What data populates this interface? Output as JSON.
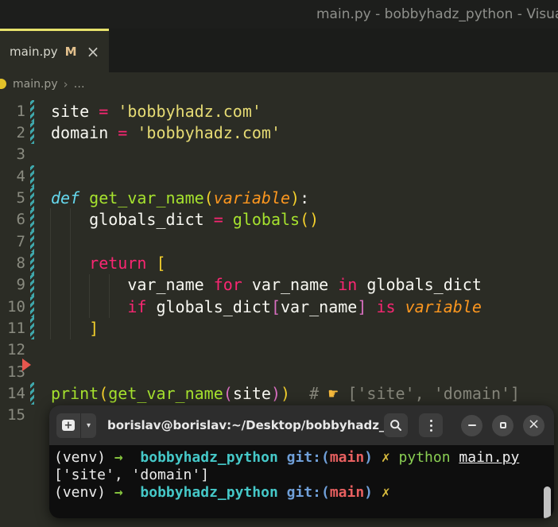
{
  "window": {
    "title": "main.py - bobbyhadz_python - Visua"
  },
  "tab": {
    "label": "main.py",
    "modified_badge": "M",
    "close_glyph": "×"
  },
  "breadcrumb": {
    "file": "main.py",
    "separator": "›",
    "ellipsis": "…"
  },
  "editor": {
    "lines": [
      {
        "num": "1",
        "gutter": "mod",
        "tokens": [
          [
            "site ",
            "w"
          ],
          [
            "= ",
            "p"
          ],
          [
            "'bobbyhadz.com'",
            "y"
          ]
        ]
      },
      {
        "num": "2",
        "gutter": "mod",
        "tokens": [
          [
            "domain ",
            "w"
          ],
          [
            "= ",
            "p"
          ],
          [
            "'bobbyhadz.com'",
            "y"
          ]
        ]
      },
      {
        "num": "3",
        "gutter": "",
        "tokens": []
      },
      {
        "num": "4",
        "gutter": "mod",
        "tokens": []
      },
      {
        "num": "5",
        "gutter": "mod",
        "tokens": [
          [
            "def ",
            "c"
          ],
          [
            "get_var_name",
            "g"
          ],
          [
            "(",
            "b1"
          ],
          [
            "variable",
            "o"
          ],
          [
            ")",
            "b1"
          ],
          [
            ":",
            "w"
          ]
        ]
      },
      {
        "num": "6",
        "gutter": "mod",
        "tokens": [
          [
            "    globals_dict ",
            "w"
          ],
          [
            "= ",
            "p"
          ],
          [
            "globals",
            "g"
          ],
          [
            "()",
            "b1"
          ]
        ]
      },
      {
        "num": "7",
        "gutter": "mod",
        "tokens": []
      },
      {
        "num": "8",
        "gutter": "mod",
        "tokens": [
          [
            "    ",
            "w"
          ],
          [
            "return",
            "p"
          ],
          [
            " ",
            "w"
          ],
          [
            "[",
            "b1"
          ]
        ]
      },
      {
        "num": "9",
        "gutter": "mod",
        "tokens": [
          [
            "        var_name ",
            "w"
          ],
          [
            "for",
            "p"
          ],
          [
            " var_name ",
            "w"
          ],
          [
            "in",
            "p"
          ],
          [
            " globals_dict",
            "w"
          ]
        ]
      },
      {
        "num": "10",
        "gutter": "mod",
        "tokens": [
          [
            "        ",
            "w"
          ],
          [
            "if",
            "p"
          ],
          [
            " globals_dict",
            "w"
          ],
          [
            "[",
            "b2"
          ],
          [
            "var_name",
            "w"
          ],
          [
            "]",
            "b2"
          ],
          [
            " ",
            "w"
          ],
          [
            "is",
            "p"
          ],
          [
            " ",
            "w"
          ],
          [
            "variable",
            "o"
          ]
        ]
      },
      {
        "num": "11",
        "gutter": "mod",
        "tokens": [
          [
            "    ",
            "w"
          ],
          [
            "]",
            "b1"
          ]
        ]
      },
      {
        "num": "12",
        "gutter": "",
        "tokens": []
      },
      {
        "num": "13",
        "gutter": "",
        "tokens": []
      },
      {
        "num": "14",
        "gutter": "mod",
        "tokens": [
          [
            "print",
            "g"
          ],
          [
            "(",
            "b1"
          ],
          [
            "get_var_name",
            "g"
          ],
          [
            "(",
            "b2"
          ],
          [
            "site",
            "w"
          ],
          [
            ")",
            "b2"
          ],
          [
            ")",
            "b1"
          ],
          [
            "  ",
            "w"
          ],
          [
            "# ",
            "cm"
          ],
          [
            "☛",
            "em"
          ],
          [
            " ['site', 'domain']",
            "cm"
          ]
        ]
      },
      {
        "num": "15",
        "gutter": "",
        "tokens": []
      }
    ]
  },
  "terminal": {
    "header": {
      "title": "borislav@borislav:~/Desktop/bobbyhadz_...",
      "new_tab_plus": "+",
      "dropdown_glyph": "▾",
      "close_glyph": "×"
    },
    "lines": [
      {
        "tokens": [
          [
            "(venv) ",
            "tw"
          ],
          [
            "→",
            "tg"
          ],
          [
            "  ",
            "tw"
          ],
          [
            "bobbyhadz_python",
            "tc"
          ],
          [
            " ",
            "tw"
          ],
          [
            "git:(",
            "tb"
          ],
          [
            "main",
            "tr"
          ],
          [
            ")",
            "tb"
          ],
          [
            " ",
            "tw"
          ],
          [
            "✗",
            "ty"
          ],
          [
            " ",
            "tw"
          ],
          [
            "python",
            "tgr"
          ],
          [
            " ",
            "tw"
          ],
          [
            "main.py",
            "tu"
          ]
        ]
      },
      {
        "tokens": [
          [
            "['site', 'domain']",
            "tw"
          ]
        ]
      },
      {
        "tokens": [
          [
            "(venv) ",
            "tw"
          ],
          [
            "→",
            "tg"
          ],
          [
            "  ",
            "tw"
          ],
          [
            "bobbyhadz_python",
            "tc"
          ],
          [
            " ",
            "tw"
          ],
          [
            "git:(",
            "tb"
          ],
          [
            "main",
            "tr"
          ],
          [
            ")",
            "tb"
          ],
          [
            " ",
            "tw"
          ],
          [
            "✗",
            "ty"
          ]
        ]
      }
    ]
  },
  "colors": {
    "editor_bg": "#2b2c25",
    "tab_accent": "#e6e16b",
    "modified_badge": "#e2c08d",
    "keyword": "#f92672",
    "string": "#e6db74",
    "function": "#a6e22e",
    "def_keyword": "#66d9ef",
    "parameter": "#fd971f",
    "comment": "#85857a",
    "bracket_level1": "#f3cf2c",
    "bracket_level2": "#d86ec0",
    "gutter_modified": "#3fa7ab",
    "gutter_deleted": "#e8564e",
    "terminal_green": "#83c03d",
    "terminal_cyan": "#45c8c8",
    "terminal_blue": "#6f9fd8",
    "terminal_red": "#e86060",
    "terminal_yellow": "#d9bc3e"
  }
}
